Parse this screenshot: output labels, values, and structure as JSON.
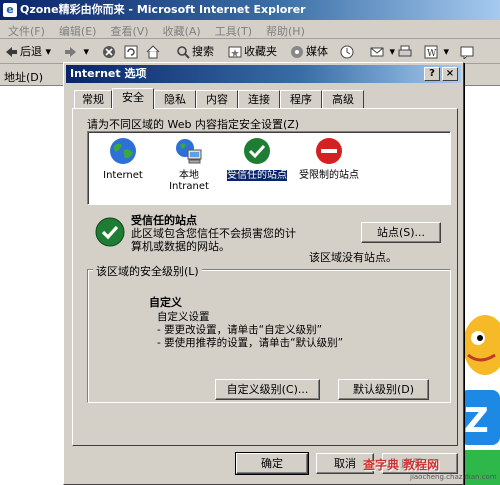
{
  "browser": {
    "title": "Qzone精彩由你而来 - Microsoft Internet Explorer",
    "menu": [
      "文件(F)",
      "编辑(E)",
      "查看(V)",
      "收藏(A)",
      "工具(T)",
      "帮助(H)"
    ],
    "toolbar": {
      "back": "后退",
      "search": "搜索",
      "favorites": "收藏夹",
      "media": "媒体"
    },
    "address_label": "地址(D)"
  },
  "dialog": {
    "title": "Internet 选项",
    "help": "?",
    "close": "×",
    "tabs": [
      "常规",
      "安全",
      "隐私",
      "内容",
      "连接",
      "程序",
      "高级"
    ],
    "active_tab": "安全",
    "zone_prompt": "请为不同区域的 Web 内容指定安全设置(Z)",
    "zones": [
      {
        "label": "Internet",
        "icon": "globe-icon"
      },
      {
        "label": "本地 Intranet",
        "icon": "intranet-icon"
      },
      {
        "label": "受信任的站点",
        "icon": "trusted-check-icon"
      },
      {
        "label": "受限制的站点",
        "icon": "restricted-icon"
      }
    ],
    "selected_zone": "受信任的站点",
    "zone_info_title": "受信任的站点",
    "zone_info_desc": "此区域包含您信任不会损害您的计算机或数据的网站。",
    "sites_button": "站点(S)...",
    "no_sites_text": "该区域没有站点。",
    "security_level_label": "该区域的安全级别(L)",
    "custom_title": "自定义",
    "custom_lines": [
      "自定义设置",
      "- 要更改设置，请单击“自定义级别”",
      "- 要使用推荐的设置，请单击“默认级别”"
    ],
    "custom_level_button": "自定义级别(C)...",
    "default_level_button": "默认级别(D)",
    "ok": "确定",
    "cancel": "取消",
    "apply": "应用(A)"
  },
  "watermark": {
    "text": "查字典 教程网",
    "sub": "jiaocheng.chazidian.com"
  },
  "colors": {
    "titlebar": "#0a246a",
    "dialog_bg": "#d4d0c8",
    "trusted_green": "#1e7d32",
    "restricted_red": "#d42020"
  }
}
